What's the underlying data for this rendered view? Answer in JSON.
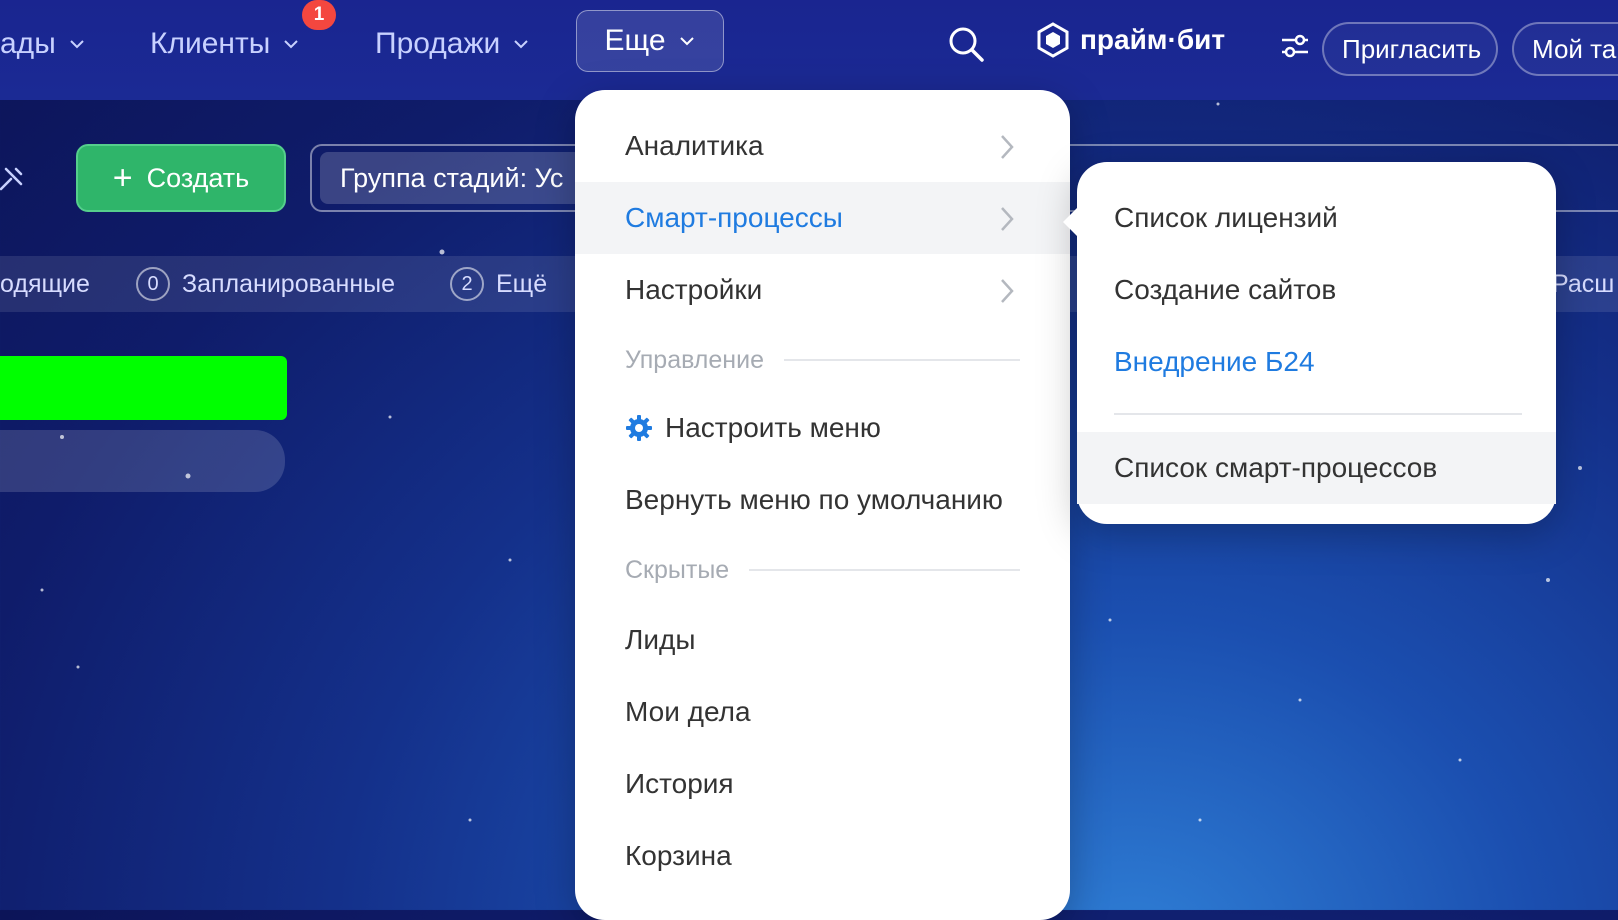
{
  "top_nav": {
    "items": [
      {
        "label": "ады"
      },
      {
        "label": "Клиенты",
        "badge": "1"
      },
      {
        "label": "Продажи"
      }
    ],
    "more_label": "Еще",
    "logo_text": "прайм·бит",
    "invite_label": "Пригласить",
    "plan_label": "Мой тар"
  },
  "toolbar": {
    "create_label": "Создать",
    "filter_chip": "Группа стадий: Ус"
  },
  "counters": [
    {
      "label": "одящие"
    },
    {
      "count": "0",
      "label": "Запланированные"
    },
    {
      "count": "2",
      "label": "Ещё"
    },
    {
      "label": "Расш"
    }
  ],
  "dropdown": {
    "items": [
      {
        "label": "Аналитика",
        "has_submenu": true
      },
      {
        "label": "Смарт-процессы",
        "has_submenu": true,
        "active": true
      },
      {
        "label": "Настройки",
        "has_submenu": true
      }
    ],
    "section_manage": "Управление",
    "configure_label": "Настроить меню",
    "reset_label": "Вернуть меню по умолчанию",
    "section_hidden": "Скрытые",
    "hidden_items": [
      {
        "label": "Лиды"
      },
      {
        "label": "Мои дела"
      },
      {
        "label": "История"
      },
      {
        "label": "Корзина"
      }
    ]
  },
  "submenu": {
    "items": [
      {
        "label": "Список лицензий"
      },
      {
        "label": "Создание сайтов"
      },
      {
        "label": "Внедрение Б24",
        "link": true
      }
    ],
    "footer_item": "Список смарт-процессов"
  },
  "colors": {
    "accent_blue": "#1f7be0",
    "create_green": "#2fb56a",
    "badge_red": "#f4473f",
    "highlight_green": "#00ff00"
  }
}
